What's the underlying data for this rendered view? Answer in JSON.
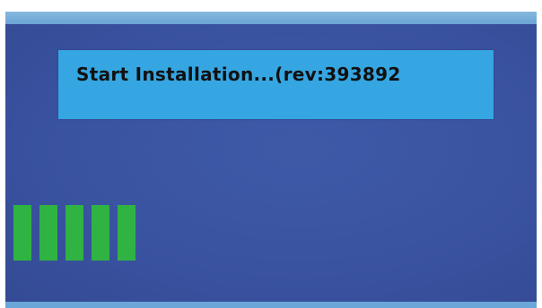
{
  "message": {
    "text": "Start Installation...(rev:393892"
  },
  "progress": {
    "segments_filled": 5,
    "color": "#2fb342"
  },
  "colors": {
    "background": "#3a53a1",
    "message_box": "#35a6e2",
    "top_bar": "#86b9de"
  }
}
